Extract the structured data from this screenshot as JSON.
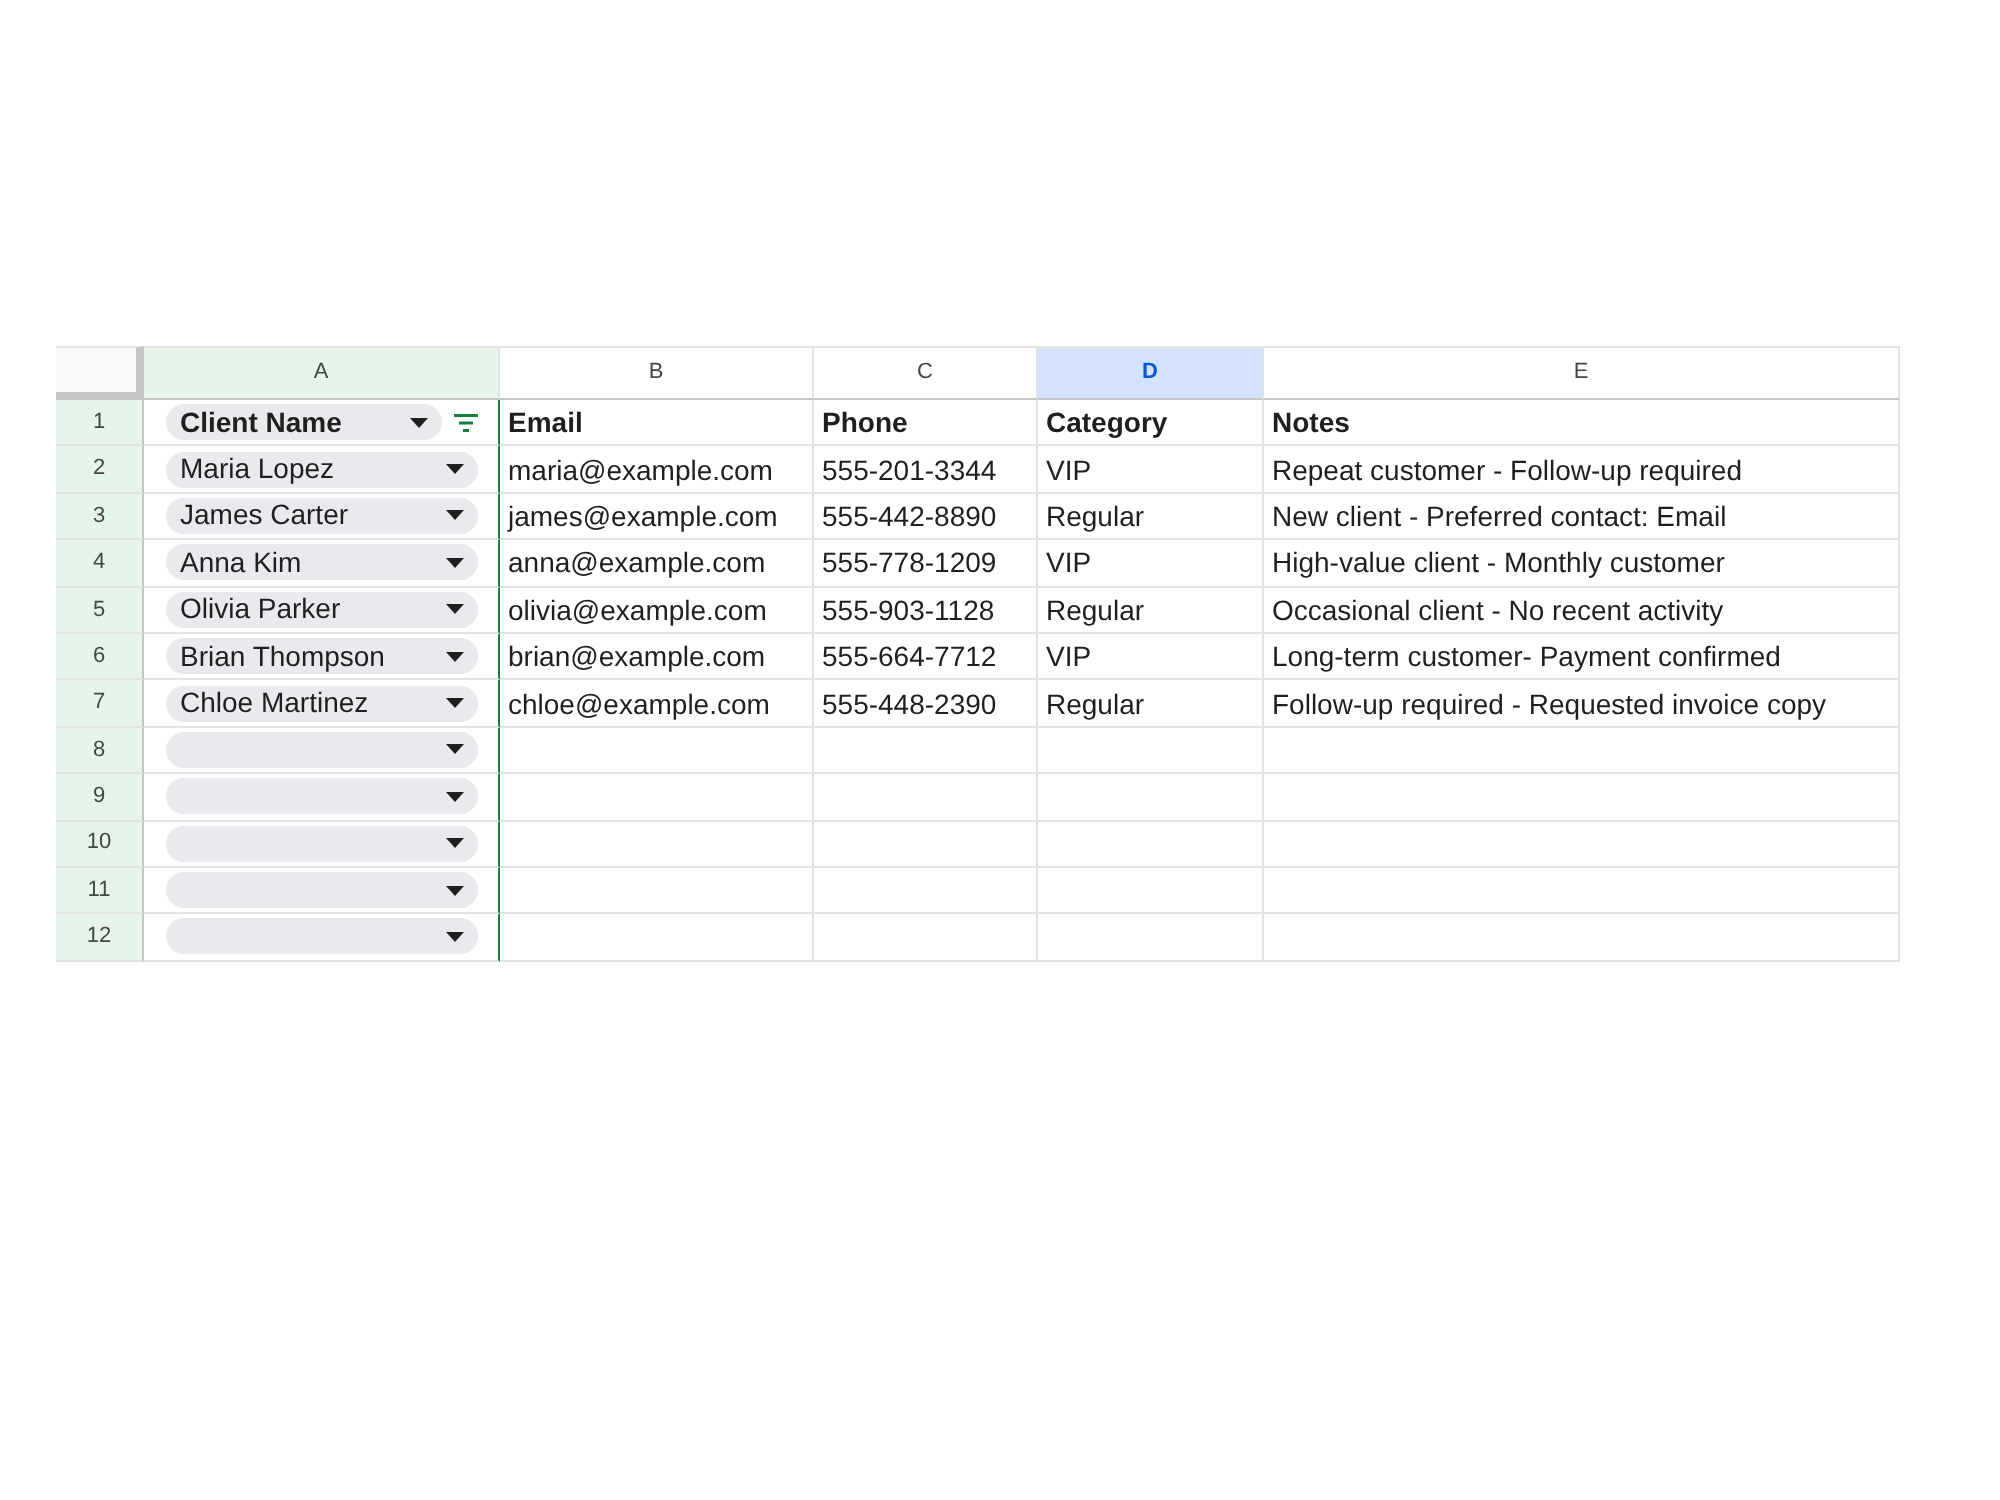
{
  "sheet": {
    "columns": [
      {
        "letter": "A",
        "kind": "dropdown",
        "selected": false,
        "filtered": true
      },
      {
        "letter": "B",
        "kind": "text",
        "selected": false,
        "filtered": false
      },
      {
        "letter": "C",
        "kind": "text",
        "selected": false,
        "filtered": false
      },
      {
        "letter": "D",
        "kind": "text",
        "selected": true,
        "filtered": false
      },
      {
        "letter": "E",
        "kind": "text",
        "selected": false,
        "filtered": false
      }
    ],
    "rows": [
      {
        "number": "1",
        "kind": "header",
        "cells": [
          "Client Name",
          "Email",
          "Phone",
          "Category",
          "Notes"
        ]
      },
      {
        "number": "2",
        "kind": "data",
        "cells": [
          "Maria Lopez",
          "maria@example.com",
          "555-201-3344",
          "VIP",
          "Repeat customer - Follow-up required"
        ]
      },
      {
        "number": "3",
        "kind": "data",
        "cells": [
          "James Carter",
          "james@example.com",
          "555-442-8890",
          "Regular",
          "New client - Preferred contact: Email"
        ]
      },
      {
        "number": "4",
        "kind": "data",
        "cells": [
          "Anna Kim",
          "anna@example.com",
          "555-778-1209",
          "VIP",
          "High-value client - Monthly customer"
        ]
      },
      {
        "number": "5",
        "kind": "data",
        "cells": [
          "Olivia Parker",
          "olivia@example.com",
          "555-903-1128",
          "Regular",
          "Occasional client - No recent activity"
        ]
      },
      {
        "number": "6",
        "kind": "data",
        "cells": [
          "Brian Thompson",
          "brian@example.com",
          "555-664-7712",
          "VIP",
          "Long-term customer- Payment confirmed"
        ]
      },
      {
        "number": "7",
        "kind": "data",
        "cells": [
          "Chloe Martinez",
          "chloe@example.com",
          "555-448-2390",
          "Regular",
          "Follow-up required - Requested invoice copy"
        ]
      },
      {
        "number": "8",
        "kind": "data"
      },
      {
        "number": "9",
        "kind": "data"
      },
      {
        "number": "10",
        "kind": "data"
      },
      {
        "number": "11",
        "kind": "data"
      },
      {
        "number": "12",
        "kind": "data"
      }
    ]
  }
}
